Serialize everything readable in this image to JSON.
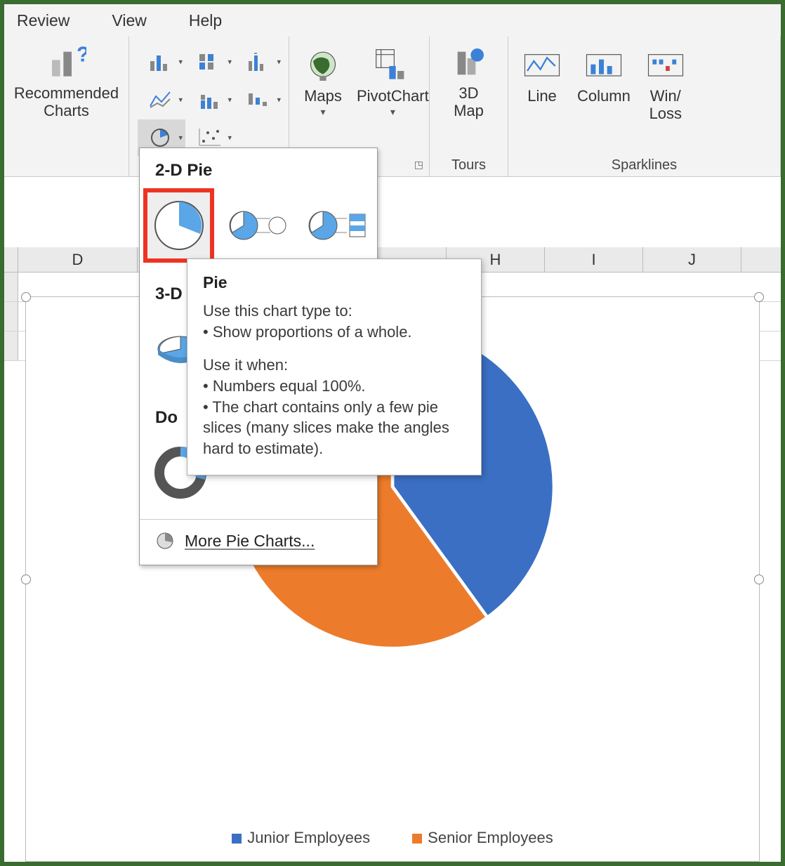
{
  "menu": {
    "review": "Review",
    "view": "View",
    "help": "Help"
  },
  "ribbon": {
    "recommended": "Recommended\nCharts",
    "maps": "Maps",
    "pivotchart": "PivotChart",
    "map3d": "3D\nMap",
    "line": "Line",
    "column": "Column",
    "winloss": "Win/\nLoss",
    "group_tours": "Tours",
    "group_sparklines": "Sparklines"
  },
  "dropdown": {
    "sec_2d": "2-D Pie",
    "sec_3d": "3-D",
    "sec_donut": "Do",
    "more": "More Pie Charts..."
  },
  "tooltip": {
    "title": "Pie",
    "l1": "Use this chart type to:",
    "l2": "• Show proportions of a whole.",
    "l3": "Use it when:",
    "l4": "• Numbers equal 100%.",
    "l5": "• The chart contains only a few pie slices (many slices make the angles hard to estimate)."
  },
  "columns": [
    "D",
    "H",
    "I",
    "J"
  ],
  "chart_data": {
    "type": "pie",
    "title": "",
    "series": [
      {
        "name": "Junior Employees",
        "value": 40,
        "color": "#3b6fc4"
      },
      {
        "name": "Senior Employees",
        "value": 60,
        "color": "#ec7c2b"
      }
    ]
  }
}
